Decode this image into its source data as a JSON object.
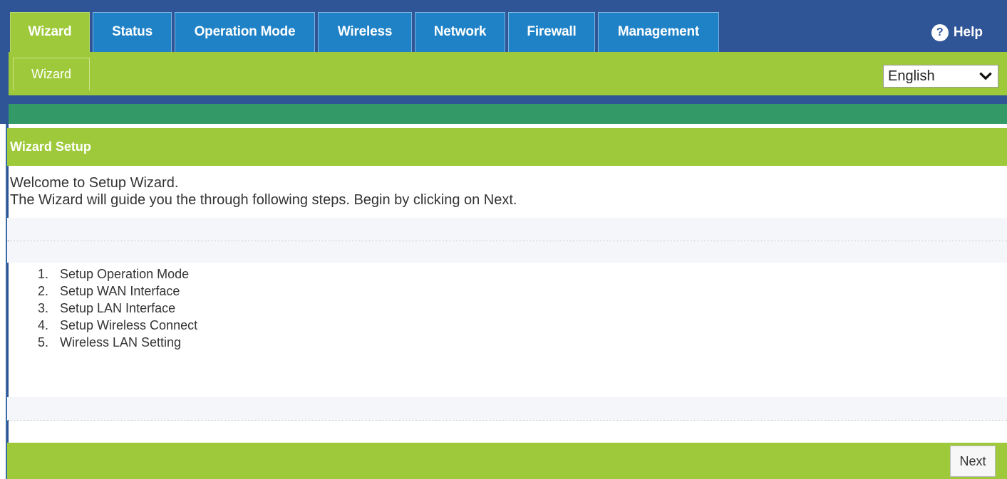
{
  "nav": {
    "tabs": [
      {
        "label": "Wizard",
        "active": true
      },
      {
        "label": "Status"
      },
      {
        "label": "Operation Mode"
      },
      {
        "label": "Wireless"
      },
      {
        "label": "Network"
      },
      {
        "label": "Firewall"
      },
      {
        "label": "Management"
      }
    ],
    "help_label": "Help"
  },
  "subnav": {
    "active_label": "Wizard",
    "language": "English"
  },
  "section": {
    "title": "Wizard Setup",
    "intro_line1": "Welcome to Setup Wizard.",
    "intro_line2": "The Wizard will guide you the through following steps. Begin by clicking on Next."
  },
  "steps": [
    {
      "num": "1.",
      "label": "Setup Operation Mode"
    },
    {
      "num": "2.",
      "label": "Setup WAN Interface"
    },
    {
      "num": "3.",
      "label": "Setup LAN Interface"
    },
    {
      "num": "4.",
      "label": "Setup Wireless Connect"
    },
    {
      "num": "5.",
      "label": "Wireless LAN Setting"
    }
  ],
  "footer": {
    "next_label": "Next"
  },
  "colors": {
    "nav_blue": "#2f5597",
    "tab_blue": "#1f82c7",
    "accent_green": "#9ec93a",
    "teal": "#339967"
  }
}
